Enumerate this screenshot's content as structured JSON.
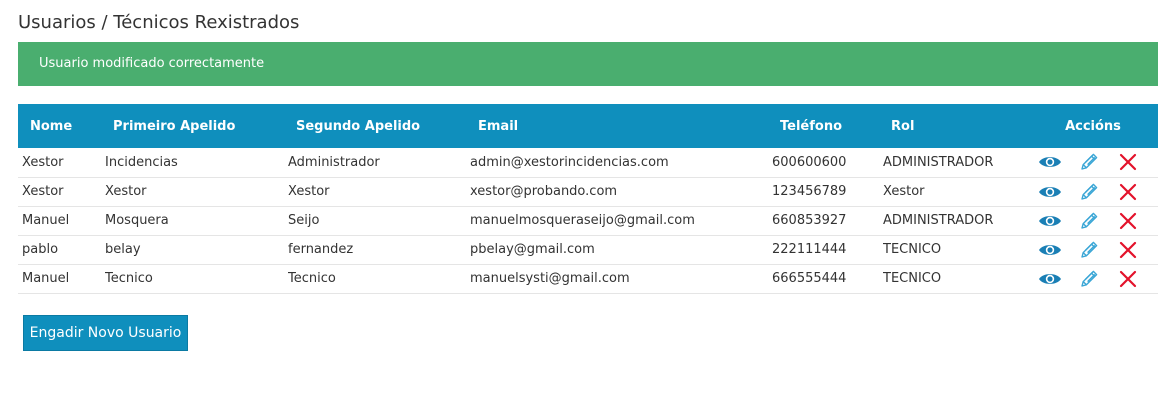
{
  "page": {
    "title": "Usuarios / Técnicos Rexistrados"
  },
  "alert": {
    "message": "Usuario modificado correctamente",
    "color": "#4aae6f"
  },
  "table": {
    "headers": {
      "nome": "Nome",
      "primeiro_apelido": "Primeiro Apelido",
      "segundo_apelido": "Segundo Apelido",
      "email": "Email",
      "telefono": "Teléfono",
      "rol": "Rol",
      "accions": "Accións"
    },
    "header_color": "#0f8fbd",
    "rows": [
      {
        "nome": "Xestor",
        "primeiro_apelido": "Incidencias",
        "segundo_apelido": "Administrador",
        "email": "admin@xestorincidencias.com",
        "telefono": "600600600",
        "rol": "ADMINISTRADOR"
      },
      {
        "nome": "Xestor",
        "primeiro_apelido": "Xestor",
        "segundo_apelido": "Xestor",
        "email": "xestor@probando.com",
        "telefono": "123456789",
        "rol": "Xestor"
      },
      {
        "nome": "Manuel",
        "primeiro_apelido": "Mosquera",
        "segundo_apelido": "Seijo",
        "email": "manuelmosqueraseijo@gmail.com",
        "telefono": "660853927",
        "rol": "ADMINISTRADOR"
      },
      {
        "nome": "pablo",
        "primeiro_apelido": "belay",
        "segundo_apelido": "fernandez",
        "email": "pbelay@gmail.com",
        "telefono": "222111444",
        "rol": "TECNICO"
      },
      {
        "nome": "Manuel",
        "primeiro_apelido": "Tecnico",
        "segundo_apelido": "Tecnico",
        "email": "manuelsysti@gmail.com",
        "telefono": "666555444",
        "rol": "TECNICO"
      }
    ],
    "action_icons": [
      "eye-icon",
      "pencil-icon",
      "close-icon"
    ],
    "action_colors": {
      "view": "#1a7fb5",
      "edit": "#3aa6d6",
      "delete": "#e3122b"
    }
  },
  "add_button": {
    "label": "Engadir Novo Usuario"
  }
}
